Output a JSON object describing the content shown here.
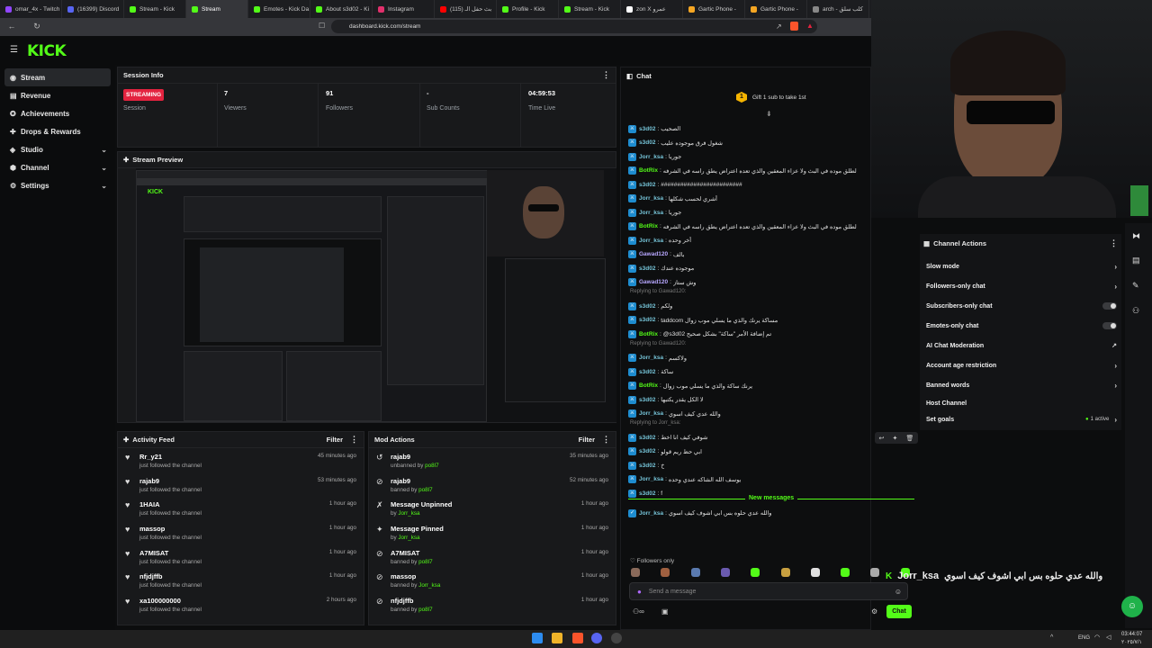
{
  "tabs": [
    {
      "label": "omar_4x - Twitch",
      "color": "#9146ff"
    },
    {
      "label": "(16399) Discord",
      "color": "#5865f2"
    },
    {
      "label": "Stream - Kick",
      "color": "#53fc18"
    },
    {
      "label": "Stream",
      "color": "#53fc18",
      "active": true
    },
    {
      "label": "Emotes - Kick Da",
      "color": "#53fc18"
    },
    {
      "label": "About s3d02 - Ki",
      "color": "#53fc18"
    },
    {
      "label": "Instagram",
      "color": "#e1306c"
    },
    {
      "label": "(115) بث حفل الـ",
      "color": "#ff0000"
    },
    {
      "label": "Profile - Kick",
      "color": "#53fc18"
    },
    {
      "label": "Stream - Kick",
      "color": "#53fc18"
    },
    {
      "label": "zon X عمرو",
      "color": "#ffffff"
    },
    {
      "label": "Gartic Phone -",
      "color": "#f5a623"
    },
    {
      "label": "Gartic Phone -",
      "color": "#f5a623"
    },
    {
      "label": "arch - كلب سلق",
      "color": "#888888"
    }
  ],
  "address": {
    "url": "dashboard.kick.com/stream"
  },
  "brand": {
    "logo": "KICK",
    "accent": "#53fc18"
  },
  "sidebar": {
    "items": [
      {
        "label": "Stream",
        "icon": "broadcast-icon"
      },
      {
        "label": "Revenue",
        "icon": "revenue-icon"
      },
      {
        "label": "Achievements",
        "icon": "trophy-icon"
      },
      {
        "label": "Drops & Rewards",
        "icon": "gift-icon"
      },
      {
        "label": "Studio",
        "icon": "studio-icon"
      },
      {
        "label": "Channel",
        "icon": "channel-icon"
      },
      {
        "label": "Settings",
        "icon": "gear-icon"
      }
    ]
  },
  "session": {
    "title": "Session Info",
    "status": "STREAMING",
    "stats": [
      {
        "value": "",
        "label": "Session"
      },
      {
        "value": "7",
        "label": "Viewers"
      },
      {
        "value": "91",
        "label": "Followers"
      },
      {
        "value": "-",
        "label": "Sub Counts"
      },
      {
        "value": "04:59:53",
        "label": "Time Live"
      }
    ]
  },
  "preview": {
    "title": "Stream Preview"
  },
  "activity": {
    "title": "Activity Feed",
    "filter": "Filter",
    "rows": [
      {
        "name": "Rr_y21",
        "sub": "just followed the channel",
        "time": "45 minutes ago"
      },
      {
        "name": "rajab9",
        "sub": "just followed the channel",
        "time": "53 minutes ago"
      },
      {
        "name": "1HAIA",
        "sub": "just followed the channel",
        "time": "1 hour ago"
      },
      {
        "name": "massop",
        "sub": "just followed the channel",
        "time": "1 hour ago"
      },
      {
        "name": "A7MISAT",
        "sub": "just followed the channel",
        "time": "1 hour ago"
      },
      {
        "name": "nfjdjffb",
        "sub": "just followed the channel",
        "time": "1 hour ago"
      },
      {
        "name": "xa100000000",
        "sub": "just followed the channel",
        "time": "2 hours ago"
      }
    ]
  },
  "mod": {
    "title": "Mod Actions",
    "filter": "Filter",
    "rows": [
      {
        "name": "rajab9",
        "pre": "unbanned by",
        "by": "po8l7",
        "time": "35 minutes ago",
        "icon": "undo-icon"
      },
      {
        "name": "rajab9",
        "pre": "banned by",
        "by": "po8l7",
        "time": "52 minutes ago",
        "icon": "ban-icon"
      },
      {
        "name": "Message Unpinned",
        "pre": "by",
        "by": "Jorr_ksa",
        "time": "1 hour ago",
        "icon": "unpin-icon"
      },
      {
        "name": "Message Pinned",
        "pre": "by",
        "by": "Jorr_ksa",
        "time": "1 hour ago",
        "icon": "pin-icon"
      },
      {
        "name": "A7MISAT",
        "pre": "banned by",
        "by": "po8l7",
        "time": "1 hour ago",
        "icon": "ban-icon"
      },
      {
        "name": "massop",
        "pre": "banned by",
        "by": "Jorr_ksa",
        "time": "1 hour ago",
        "icon": "ban-icon"
      },
      {
        "name": "nfjdjffb",
        "pre": "banned by",
        "by": "po8l7",
        "time": "1 hour ago",
        "icon": "ban-icon"
      }
    ]
  },
  "chat": {
    "title": "Chat",
    "gift": "Gift 1 sub to take 1st",
    "gift_rank": "1",
    "messages": [
      {
        "user": "s3d02",
        "text": "الصحيب"
      },
      {
        "user": "s3d02",
        "text": "شغول فرق موجوده عليب"
      },
      {
        "user": "Jorr_ksa",
        "text": "جوريا"
      },
      {
        "user": "BotRix",
        "text": "لطلق موده في البث ولا عزاء المعقين والذي تعده اعتراض يطق راسه في الشرفه",
        "bot": true
      },
      {
        "user": "s3d02",
        "text": "#########################"
      },
      {
        "user": "Jorr_ksa",
        "text": "أشري لحسب شكلها"
      },
      {
        "user": "Jorr_ksa",
        "text": "جوريا"
      },
      {
        "user": "BotRix",
        "text": "لطلق موده في البث ولا عزاء المعقين والذي تعده اعتراض يطق راسه في الشرفه",
        "bot": true
      },
      {
        "user": "Jorr_ksa",
        "text": "أخر وحده"
      },
      {
        "user": "Gawad120",
        "text": "بالف"
      },
      {
        "user": "s3d02",
        "text": "موجوده عندك"
      },
      {
        "user": "Gawad120",
        "text": "وش ستاز"
      },
      {
        "user": "s3d02",
        "text": "ولكم",
        "reply": "Replying to Gawad120:"
      },
      {
        "user": "s3d02",
        "text": "taddcom مساكة يرنك والذي ما يسلي موب زوال"
      },
      {
        "user": "BotRix",
        "text": "@s3d02 تم إضافة الأمر \"ساكة\" بشكل صحيح",
        "bot": true
      },
      {
        "user": "Jorr_ksa",
        "text": "ولاكسم",
        "reply": "Replying to Gawad120:"
      },
      {
        "user": "s3d02",
        "text": "ساكة"
      },
      {
        "user": "BotRix",
        "text": "يرنك ساكة والذي ما يسلي موب زوال",
        "bot": true
      },
      {
        "user": "s3d02",
        "text": "لا الكل يقدر يكتبها"
      },
      {
        "user": "Jorr_ksa",
        "text": "والله عدي كيف اسوي"
      },
      {
        "user": "s3d02",
        "text": "شوفي كيف انا اخط",
        "reply": "Replying to Jorr_ksa:"
      },
      {
        "user": "s3d02",
        "text": "ابي حظ ريم قولو"
      },
      {
        "user": "s3d02",
        "text": "خ"
      },
      {
        "user": "Jorr_ksa",
        "text": "يوسف الله الشاكه عندي وحده"
      },
      {
        "user": "s3d02",
        "text": "f"
      }
    ],
    "new_messages": "New messages",
    "last": {
      "user": "Jorr_ksa",
      "text": "والله عدي حلوه بس ابي اشوف كيف اسوي"
    },
    "followers_only": "Followers only",
    "placeholder": "Send a message",
    "send": "Chat"
  },
  "overlay": {
    "user": "Jorr_ksa",
    "text": "والله عدي حلوه بس ابي اشوف كيف اسوي"
  },
  "actions": {
    "title": "Channel Actions",
    "items": [
      {
        "label": "Slow mode",
        "kind": "chevron"
      },
      {
        "label": "Followers-only chat",
        "kind": "chevron"
      },
      {
        "label": "Subscribers-only chat",
        "kind": "toggle"
      },
      {
        "label": "Emotes-only chat",
        "kind": "toggle"
      },
      {
        "label": "AI Chat Moderation",
        "kind": "external"
      },
      {
        "label": "Account age restriction",
        "kind": "chevron"
      },
      {
        "label": "Banned words",
        "kind": "chevron"
      },
      {
        "label": "Host Channel",
        "kind": "none"
      },
      {
        "label": "Set goals",
        "kind": "chevron",
        "extra": "1 active"
      }
    ]
  },
  "taskbar": {
    "lang": "ENG",
    "time": "03:44:07",
    "date": "٢٠٢٥/٧/١"
  }
}
